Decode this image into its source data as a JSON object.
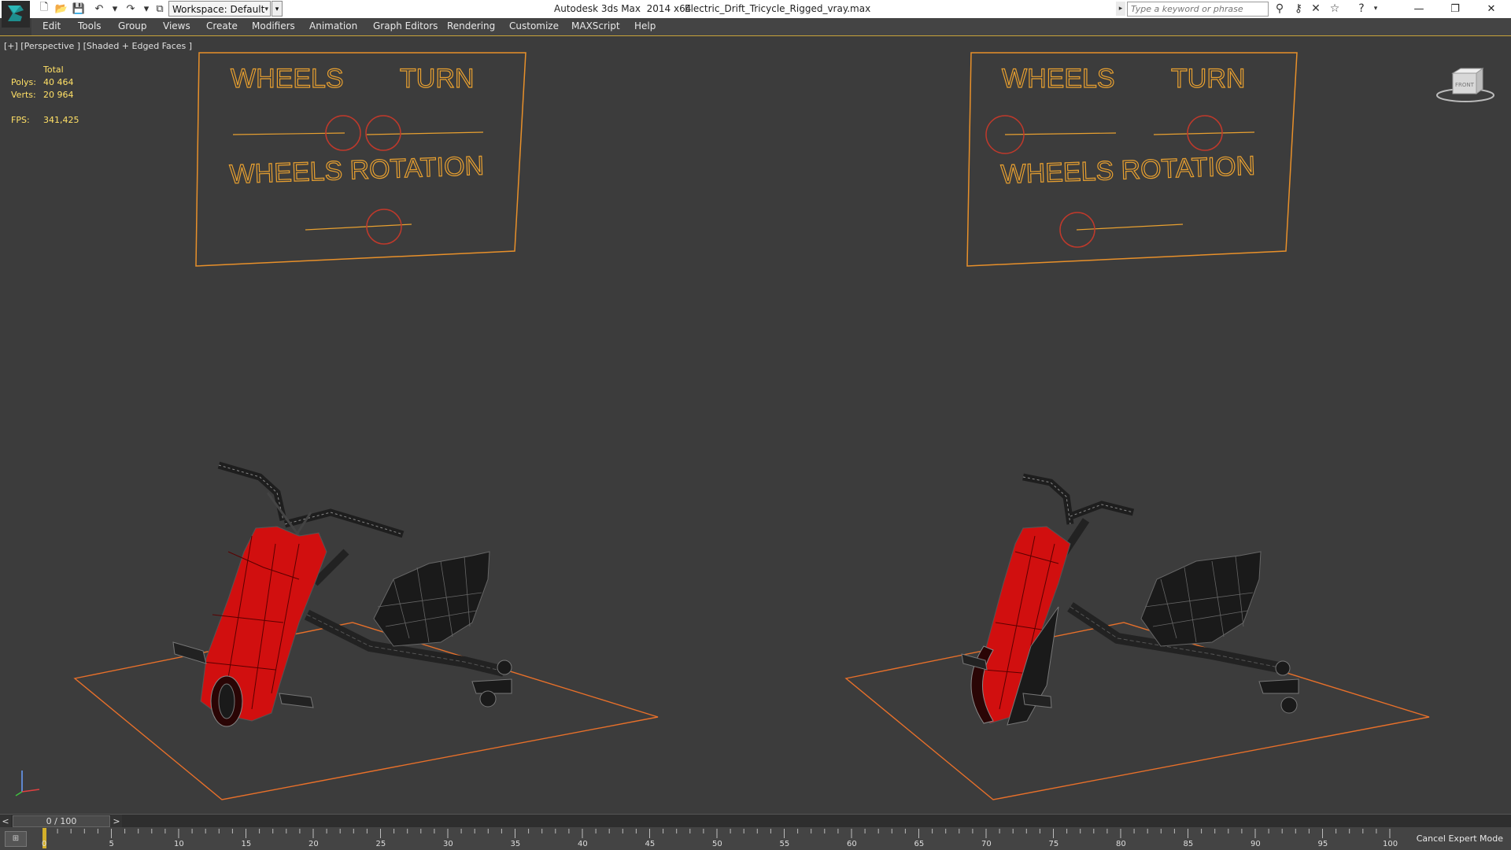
{
  "titlebar": {
    "workspace": "Workspace: Default",
    "app_name": "Autodesk 3ds Max  2014 x64",
    "file_name": "Electric_Drift_Tricycle_Rigged_vray.max",
    "search_placeholder": "Type a keyword or phrase"
  },
  "menu": [
    "Edit",
    "Tools",
    "Group",
    "Views",
    "Create",
    "Modifiers",
    "Animation",
    "Graph Editors",
    "Rendering",
    "Customize",
    "MAXScript",
    "Help"
  ],
  "viewport": {
    "label": "[+] [Perspective ] [Shaded + Edged Faces ]",
    "stats": {
      "total_label": "Total",
      "polys_label": "Polys:",
      "polys_value": "40 464",
      "verts_label": "Verts:",
      "verts_value": "20 964",
      "fps_label": "FPS:",
      "fps_value": "341,425"
    },
    "viewcube_label": "FRONT"
  },
  "rig_panels": [
    {
      "wheels": "WHEELS",
      "turn": "TURN",
      "rotation": "WHEELS ROTATION"
    },
    {
      "wheels": "WHEELS",
      "turn": "TURN",
      "rotation": "WHEELS ROTATION"
    }
  ],
  "timeslider": {
    "prev": "<",
    "next": ">",
    "frame_display": "0 / 100",
    "current_frame": 0,
    "total_frames": 100
  },
  "trackbar": {
    "ticks": [
      "0",
      "5",
      "10",
      "15",
      "20",
      "25",
      "30",
      "35",
      "40",
      "45",
      "50",
      "55",
      "60",
      "65",
      "70",
      "75",
      "80",
      "85",
      "90",
      "95",
      "100"
    ],
    "cancel_expert": "Cancel Expert Mode"
  },
  "colors": {
    "rig_orange": "#e8902a",
    "rig_red": "#c0392b",
    "body_red": "#d10f0f",
    "viewport_bg": "#3c3c3c",
    "active_border": "#c7a33a"
  }
}
